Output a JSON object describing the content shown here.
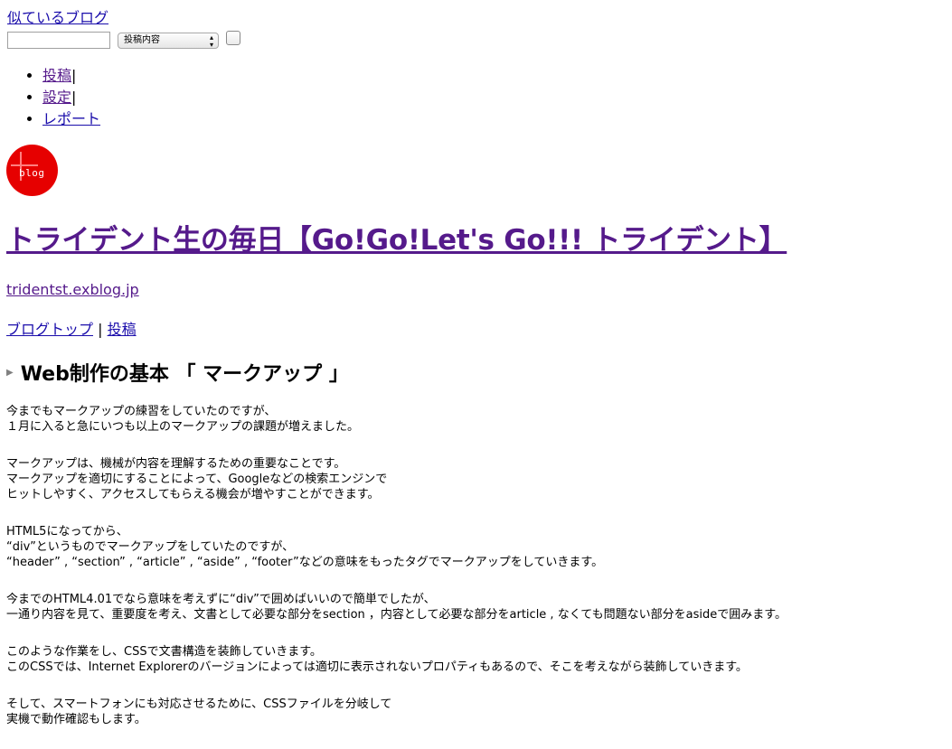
{
  "top": {
    "similar_blogs_link": "似ているブログ"
  },
  "search": {
    "input_value": "",
    "select_value": "投稿内容"
  },
  "menu": {
    "items": [
      {
        "label": "投稿",
        "sep": "|"
      },
      {
        "label": "設定",
        "sep": "|"
      },
      {
        "label": "レポート",
        "sep": ""
      }
    ]
  },
  "logo": {
    "text": "blog",
    "color": "#e60000"
  },
  "blog": {
    "title": "トライデント生の毎日【Go!Go!Let's Go!!! トライデント】",
    "url": "tridentst.exblog.jp",
    "nav_top": "ブログトップ",
    "nav_sep": " | ",
    "nav_post": "投稿"
  },
  "post": {
    "title": "Web制作の基本 「 マークアップ 」",
    "paragraphs": [
      [
        "今までもマークアップの練習をしていたのですが、",
        "１月に入ると急にいつも以上のマークアップの課題が増えました。"
      ],
      [
        "マークアップは、機械が内容を理解するための重要なことです。",
        "マークアップを適切にすることによって、Googleなどの検索エンジンで",
        "ヒットしやすく、アクセスしてもらえる機会が増やすことができます。"
      ],
      [
        "HTML5になってから、",
        "“div”というものでマークアップをしていたのですが、",
        "“header” , “section” , “article” , “aside” , “footer”などの意味をもったタグでマークアップをしていきます。"
      ],
      [
        "今までのHTML4.01でなら意味を考えずに“div”で囲めばいいので簡単でしたが、",
        "一通り内容を見て、重要度を考え、文書として必要な部分をsection ，内容として必要な部分をarticle , なくても問題ない部分をasideで囲みます。"
      ],
      [
        "このような作業をし、CSSで文書構造を装飾していきます。",
        "このCSSでは、Internet Explorerのバージョンによっては適切に表示されないプロパティもあるので、そこを考えながら装飾していきます。"
      ],
      [
        "そして、スマートフォンにも対応させるために、CSSファイルを分岐して",
        "実機で動作確認もします。"
      ]
    ]
  },
  "colors": {
    "link": "#1a0dab",
    "visited_link": "#551a8b"
  }
}
